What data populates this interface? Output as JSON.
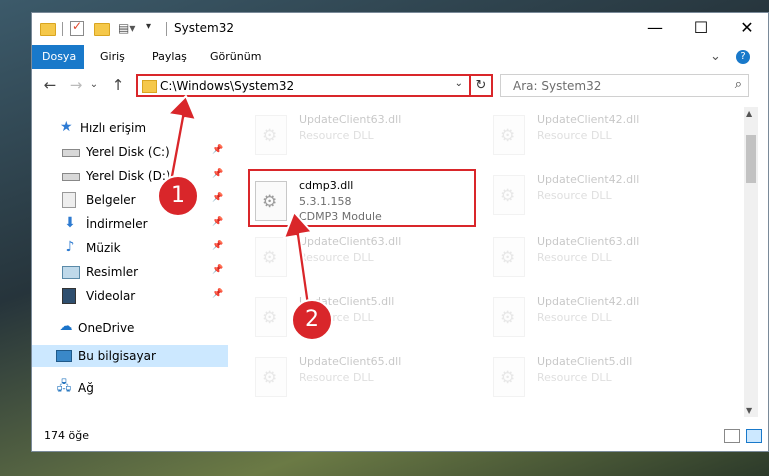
{
  "window": {
    "title": "System32"
  },
  "titlebar": {
    "minimize": "—",
    "maximize": "☐",
    "close": "✕"
  },
  "ribbon": {
    "tabs": [
      {
        "label": "Dosya",
        "active": true
      },
      {
        "label": "Giriş"
      },
      {
        "label": "Paylaş"
      },
      {
        "label": "Görünüm"
      }
    ],
    "expand": "⌄",
    "help": "?"
  },
  "nav": {
    "back": "←",
    "forward": "→",
    "recent": "⌄",
    "up": "↑"
  },
  "address": {
    "path": "C:\\Windows\\System32",
    "dropdown": "⌄",
    "refresh": "↻"
  },
  "search": {
    "placeholder": "Ara: System32",
    "icon": "⌕"
  },
  "sidebar": {
    "items": [
      {
        "label": "Hızlı erişim",
        "icon": "star-icon"
      },
      {
        "label": "Yerel Disk (C:)",
        "icon": "drive-icon",
        "pinned": true
      },
      {
        "label": "Yerel Disk (D:)",
        "icon": "drive-icon",
        "pinned": true
      },
      {
        "label": "Belgeler",
        "icon": "documents-icon",
        "pinned": true
      },
      {
        "label": "İndirmeler",
        "icon": "download-icon",
        "pinned": true
      },
      {
        "label": "Müzik",
        "icon": "music-icon",
        "pinned": true
      },
      {
        "label": "Resimler",
        "icon": "pictures-icon",
        "pinned": true
      },
      {
        "label": "Videolar",
        "icon": "videos-icon",
        "pinned": true
      },
      {
        "label": "OneDrive",
        "icon": "cloud-icon"
      },
      {
        "label": "Bu bilgisayar",
        "icon": "computer-icon",
        "selected": true
      },
      {
        "label": "Ağ",
        "icon": "network-icon"
      }
    ]
  },
  "files": {
    "highlighted": {
      "name": "cdmp3.dll",
      "version": "5.3.1.158",
      "desc": "CDMP3 Module"
    },
    "background": [
      {
        "name": "UpdateClient63.dll",
        "desc": "Resource DLL"
      },
      {
        "name": "UpdateClient42.dll",
        "desc": "Resource DLL"
      },
      {
        "name": "UpdateClient42.dll",
        "desc": "Resource DLL"
      },
      {
        "name": "UpdateClient63.dll",
        "desc": "Resource DLL"
      },
      {
        "name": "UpdateClient63.dll",
        "desc": "Resource DLL"
      },
      {
        "name": "UpdateClient5.dll",
        "desc": "Resource DLL"
      },
      {
        "name": "UpdateClient42.dll",
        "desc": "Resource DLL"
      },
      {
        "name": "UpdateClient65.dll",
        "desc": "Resource DLL"
      },
      {
        "name": "UpdateClient5.dll",
        "desc": "Resource DLL"
      }
    ]
  },
  "status": {
    "count": "174 öğe"
  },
  "annotations": {
    "step1": "1",
    "step2": "2",
    "color": "#d9262a"
  }
}
